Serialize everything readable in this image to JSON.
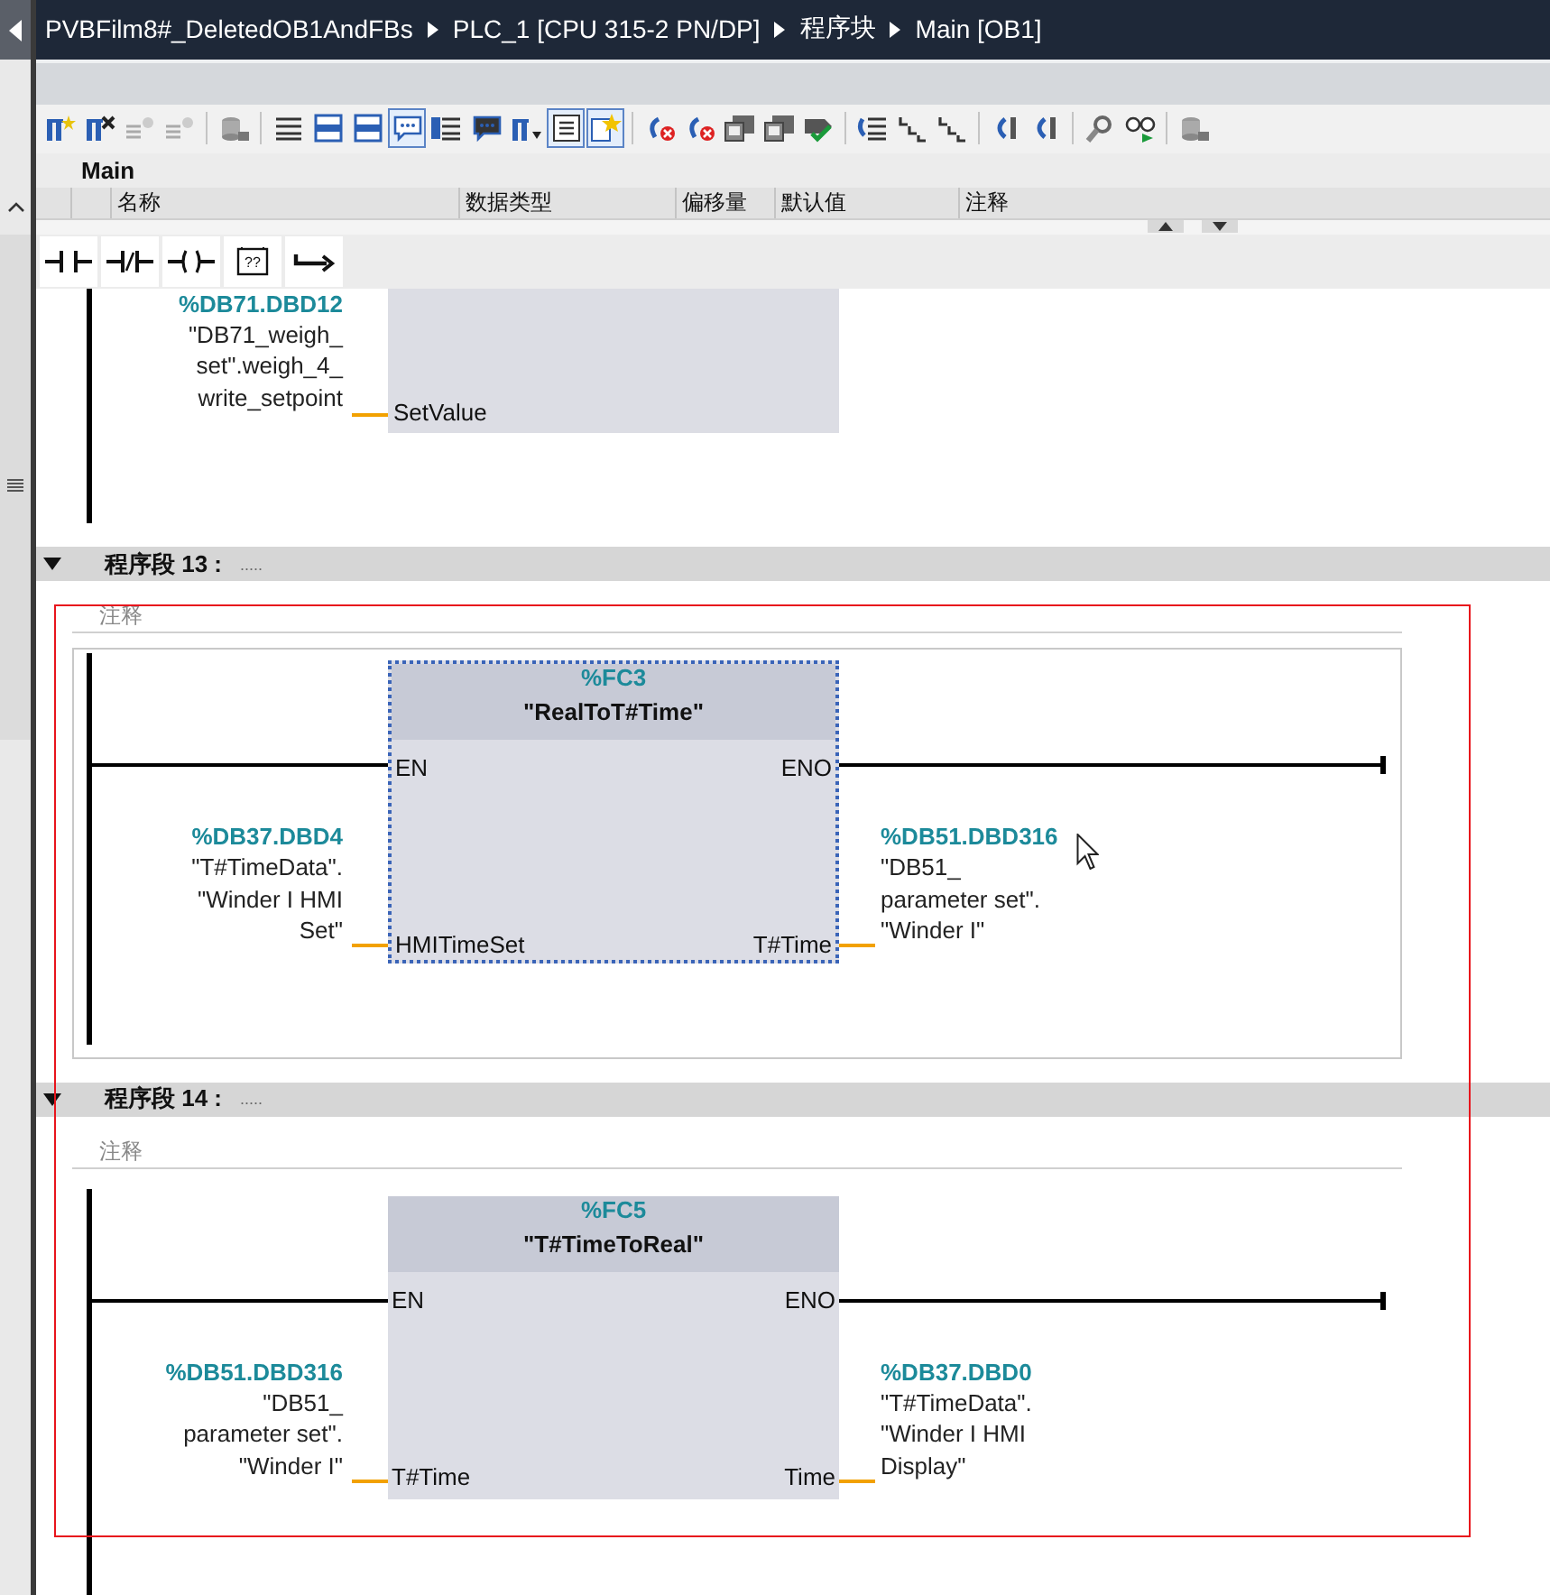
{
  "breadcrumb": [
    "PVBFilm8#_DeletedOB1AndFBs",
    "PLC_1 [CPU 315-2 PN/DP]",
    "程序块",
    "Main [OB1]"
  ],
  "toolbar": [
    [
      {
        "kind": "blocks-star",
        "selected": false
      },
      {
        "kind": "blocks-cross",
        "selected": false
      },
      {
        "kind": "lines-star",
        "selected": false
      },
      {
        "kind": "lines-star",
        "selected": false
      }
    ],
    [
      {
        "kind": "cylinder",
        "selected": false
      }
    ],
    [
      {
        "kind": "rows",
        "selected": false
      },
      {
        "kind": "panel",
        "selected": false
      },
      {
        "kind": "panel",
        "selected": false
      },
      {
        "kind": "comment",
        "selected": true
      },
      {
        "kind": "rows-dropdown",
        "selected": false
      },
      {
        "kind": "chat-dropdown",
        "selected": false
      },
      {
        "kind": "blocks-dropdown",
        "selected": false
      },
      {
        "kind": "list",
        "selected": true
      },
      {
        "kind": "star-list",
        "selected": true
      }
    ],
    [
      {
        "kind": "arrow-cross",
        "selected": false
      },
      {
        "kind": "arrow-cross",
        "selected": false
      },
      {
        "kind": "monitor",
        "selected": false
      },
      {
        "kind": "monitor",
        "selected": false
      },
      {
        "kind": "check-arrow",
        "selected": false
      }
    ],
    [
      {
        "kind": "arrow-rows",
        "selected": false
      },
      {
        "kind": "steps",
        "selected": false
      },
      {
        "kind": "steps",
        "selected": false
      }
    ],
    [
      {
        "kind": "bracket",
        "selected": false
      },
      {
        "kind": "bracket",
        "selected": false
      }
    ],
    [
      {
        "kind": "magnifier",
        "selected": false
      },
      {
        "kind": "glasses",
        "selected": false
      }
    ],
    [
      {
        "kind": "cylinder",
        "selected": false
      }
    ]
  ],
  "interface": {
    "title": "Main",
    "columns": [
      "名称",
      "数据类型",
      "偏移量",
      "默认值",
      "注释"
    ]
  },
  "lad_tools": [
    {
      "kind": "contact"
    },
    {
      "kind": "negated-contact"
    },
    {
      "kind": "coil"
    },
    {
      "kind": "empty-box",
      "label": "??"
    },
    {
      "kind": "branch"
    }
  ],
  "partial_network": {
    "input": {
      "address": "%DB71.DBD12",
      "lines": [
        "\"DB71_weigh_",
        "set\".weigh_4_",
        "write_setpoint"
      ]
    },
    "pin": "SetValue"
  },
  "networks": [
    {
      "title": "程序段 13 :",
      "dots": ".....",
      "expanded": true,
      "selected": true,
      "comment": "注释",
      "block": {
        "address": "%FC3",
        "name": "\"RealToT#Time\"",
        "selected": true,
        "en": "EN",
        "eno": "ENO",
        "input_pin": "HMITimeSet",
        "output_pin": "T#Time"
      },
      "input": {
        "address": "%DB37.DBD4",
        "lines": [
          "\"T#TimeData\".",
          "\"Winder I HMI",
          "Set\""
        ]
      },
      "output": {
        "address": "%DB51.DBD316",
        "lines": [
          "\"DB51_",
          "parameter set\".",
          "\"Winder I\""
        ]
      }
    },
    {
      "title": "程序段 14 :",
      "dots": ".....",
      "expanded": true,
      "selected": false,
      "comment": "注释",
      "block": {
        "address": "%FC5",
        "name": "\"T#TimeToReal\"",
        "selected": false,
        "en": "EN",
        "eno": "ENO",
        "input_pin": "T#Time",
        "output_pin": "Time"
      },
      "input": {
        "address": "%DB51.DBD316",
        "lines": [
          "\"DB51_",
          "parameter set\".",
          "\"Winder I\""
        ]
      },
      "output": {
        "address": "%DB37.DBD0",
        "lines": [
          "\"T#TimeData\".",
          "\"Winder I HMI",
          "Display\""
        ]
      }
    }
  ]
}
